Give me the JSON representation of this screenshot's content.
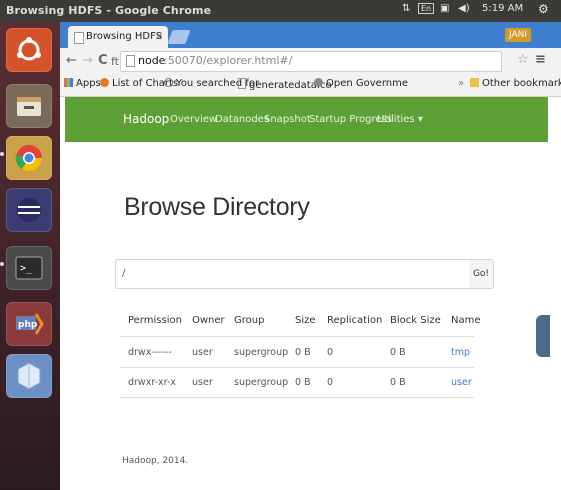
{
  "system": {
    "window_title": "Browsing HDFS - Google Chrome",
    "clock": "5:19 AM",
    "keyboard": "En"
  },
  "browser": {
    "tab_title": "Browsing HDFS",
    "tab_close": "×",
    "profile": "JANI",
    "url_host": "node",
    "url_path": ":50070/explorer.html#/",
    "back": "←",
    "forward": "→",
    "reload": "C",
    "home": "ft",
    "bookmark_star": "☆",
    "menu": "≡",
    "bookmarks": [
      {
        "label": "Apps",
        "icon": "apps-icon"
      },
      {
        "label": "List of Charts",
        "icon": "bookmark-icon"
      },
      {
        "label": "You searched for",
        "icon": "bookmark-icon"
      },
      {
        "label": "generatedata.co",
        "icon": "page-icon"
      },
      {
        "label": "Open Governme",
        "icon": "bookmark-icon"
      }
    ],
    "more_bookmarks": "»",
    "other_bookmarks": "Other bookmarks"
  },
  "navbar": {
    "brand": "Hadoop",
    "links": [
      "Overview",
      "Datanodes",
      "Snapshot",
      "Startup Progress",
      "Utilities ▾"
    ]
  },
  "page": {
    "heading": "Browse Directory",
    "path_value": "/",
    "go_label": "Go!",
    "columns": [
      "Permission",
      "Owner",
      "Group",
      "Size",
      "Replication",
      "Block Size",
      "Name"
    ],
    "rows": [
      {
        "permission": "drwx------",
        "owner": "user",
        "group": "supergroup",
        "size": "0 B",
        "replication": "0",
        "block_size": "0 B",
        "name": "tmp"
      },
      {
        "permission": "drwxr-xr-x",
        "owner": "user",
        "group": "supergroup",
        "size": "0 B",
        "replication": "0",
        "block_size": "0 B",
        "name": "user"
      }
    ],
    "footer": "Hadoop, 2014."
  },
  "colors": {
    "navbar": "#5da036",
    "link": "#3a7dc2",
    "tabstrip": "#3f7fd0"
  },
  "launcher_icons": [
    "ubuntu-dash-icon",
    "files-icon",
    "chrome-icon",
    "eclipse-icon",
    "terminal-icon",
    "php-icon",
    "virtualbox-icon"
  ]
}
